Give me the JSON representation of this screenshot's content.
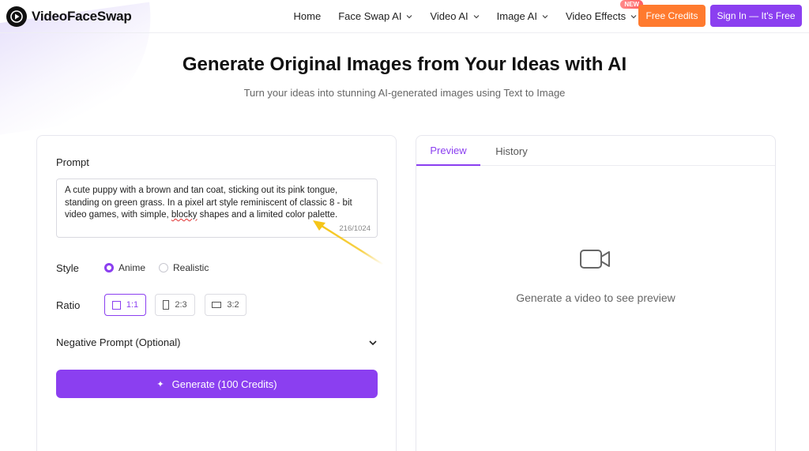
{
  "header": {
    "logo_text": "VideoFaceSwap",
    "nav": [
      {
        "label": "Home",
        "has_dropdown": false
      },
      {
        "label": "Face Swap AI",
        "has_dropdown": true
      },
      {
        "label": "Video AI",
        "has_dropdown": true
      },
      {
        "label": "Image AI",
        "has_dropdown": true
      },
      {
        "label": "Video Effects",
        "has_dropdown": true,
        "badge": "NEW"
      }
    ],
    "free_credits_label": "Free Credits",
    "sign_in_label": "Sign In — It's Free"
  },
  "hero": {
    "title": "Generate Original Images from Your Ideas with AI",
    "subtitle": "Turn your ideas into stunning AI-generated images using Text to Image"
  },
  "form": {
    "prompt_label": "Prompt",
    "prompt_text_before": "A cute puppy with a brown and tan coat, sticking out its pink tongue, standing on green grass. In a pixel art style reminiscent of classic 8 - bit video games, with simple, ",
    "prompt_text_squiggle": "blocky",
    "prompt_text_after": " shapes and a limited color palette.",
    "char_count": "216/1024",
    "style_label": "Style",
    "style_options": [
      {
        "label": "Anime",
        "selected": true
      },
      {
        "label": "Realistic",
        "selected": false
      }
    ],
    "ratio_label": "Ratio",
    "ratio_options": [
      {
        "label": "1:1",
        "selected": true
      },
      {
        "label": "2:3",
        "selected": false
      },
      {
        "label": "3:2",
        "selected": false
      }
    ],
    "negative_prompt_label": "Negative Prompt (Optional)",
    "generate_label": "Generate (100 Credits)"
  },
  "preview": {
    "tabs": [
      {
        "label": "Preview",
        "active": true
      },
      {
        "label": "History",
        "active": false
      }
    ],
    "empty_text": "Generate a video to see preview"
  },
  "colors": {
    "accent": "#8b3ff0",
    "orange": "#ff7a2e",
    "annotation_arrow": "#f5c518"
  }
}
